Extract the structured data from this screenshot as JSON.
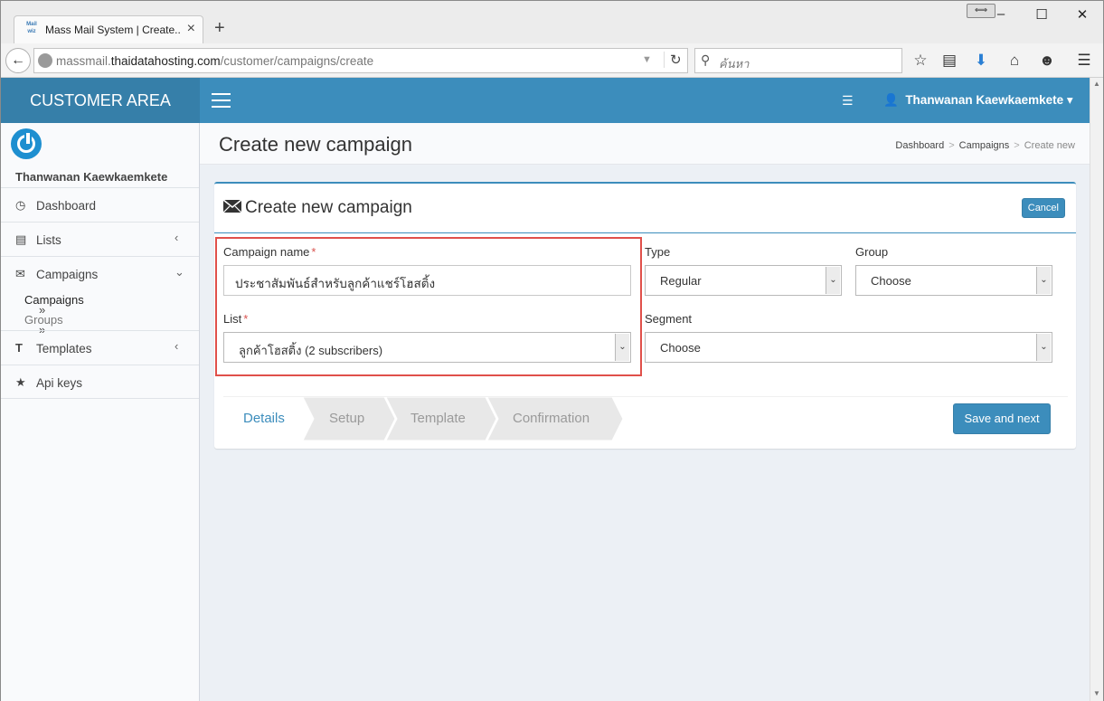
{
  "browser": {
    "tab_title": "Mass Mail System | Create...",
    "tab_favicon_text": "Mail wiz",
    "url_prefix": "massmail.",
    "url_domain": "thaidatahosting.com",
    "url_path": "/customer/campaigns/create",
    "search_placeholder": "ค้นหา"
  },
  "header": {
    "brand": "CUSTOMER AREA",
    "user_name": "Thanwanan Kaewkaemkete"
  },
  "sidebar": {
    "user_name": "Thanwanan Kaewkaemkete",
    "items": [
      {
        "label": "Dashboard",
        "icon": "dashboard-icon"
      },
      {
        "label": "Lists",
        "icon": "list-icon"
      },
      {
        "label": "Campaigns",
        "icon": "envelope-icon"
      },
      {
        "label": "Templates",
        "icon": "text-icon"
      },
      {
        "label": "Api keys",
        "icon": "star-icon"
      }
    ],
    "sub_items": [
      {
        "label": "Campaigns",
        "active": true
      },
      {
        "label": "Groups",
        "active": false
      }
    ]
  },
  "content": {
    "page_title": "Create new campaign",
    "breadcrumb": [
      "Dashboard",
      "Campaigns",
      "Create new"
    ]
  },
  "box": {
    "title": "Create new campaign",
    "cancel_label": "Cancel"
  },
  "form": {
    "campaign_name_label": "Campaign name",
    "campaign_name_value": "ประชาสัมพันธ์สำหรับลูกค้าแชร์โฮสติ้ง",
    "list_label": "List",
    "list_value": "ลูกค้าโฮสติ้ง (2 subscribers)",
    "type_label": "Type",
    "type_value": "Regular",
    "group_label": "Group",
    "group_value": "Choose",
    "segment_label": "Segment",
    "segment_value": "Choose",
    "required_mark": "*"
  },
  "wizard": {
    "steps": [
      "Details",
      "Setup",
      "Template",
      "Confirmation"
    ],
    "active_step": 0,
    "save_label": "Save and next"
  },
  "colors": {
    "accent": "#3c8dbc",
    "accent_dark": "#367fa9",
    "highlight": "#e0504a",
    "required": "#d9534f"
  }
}
